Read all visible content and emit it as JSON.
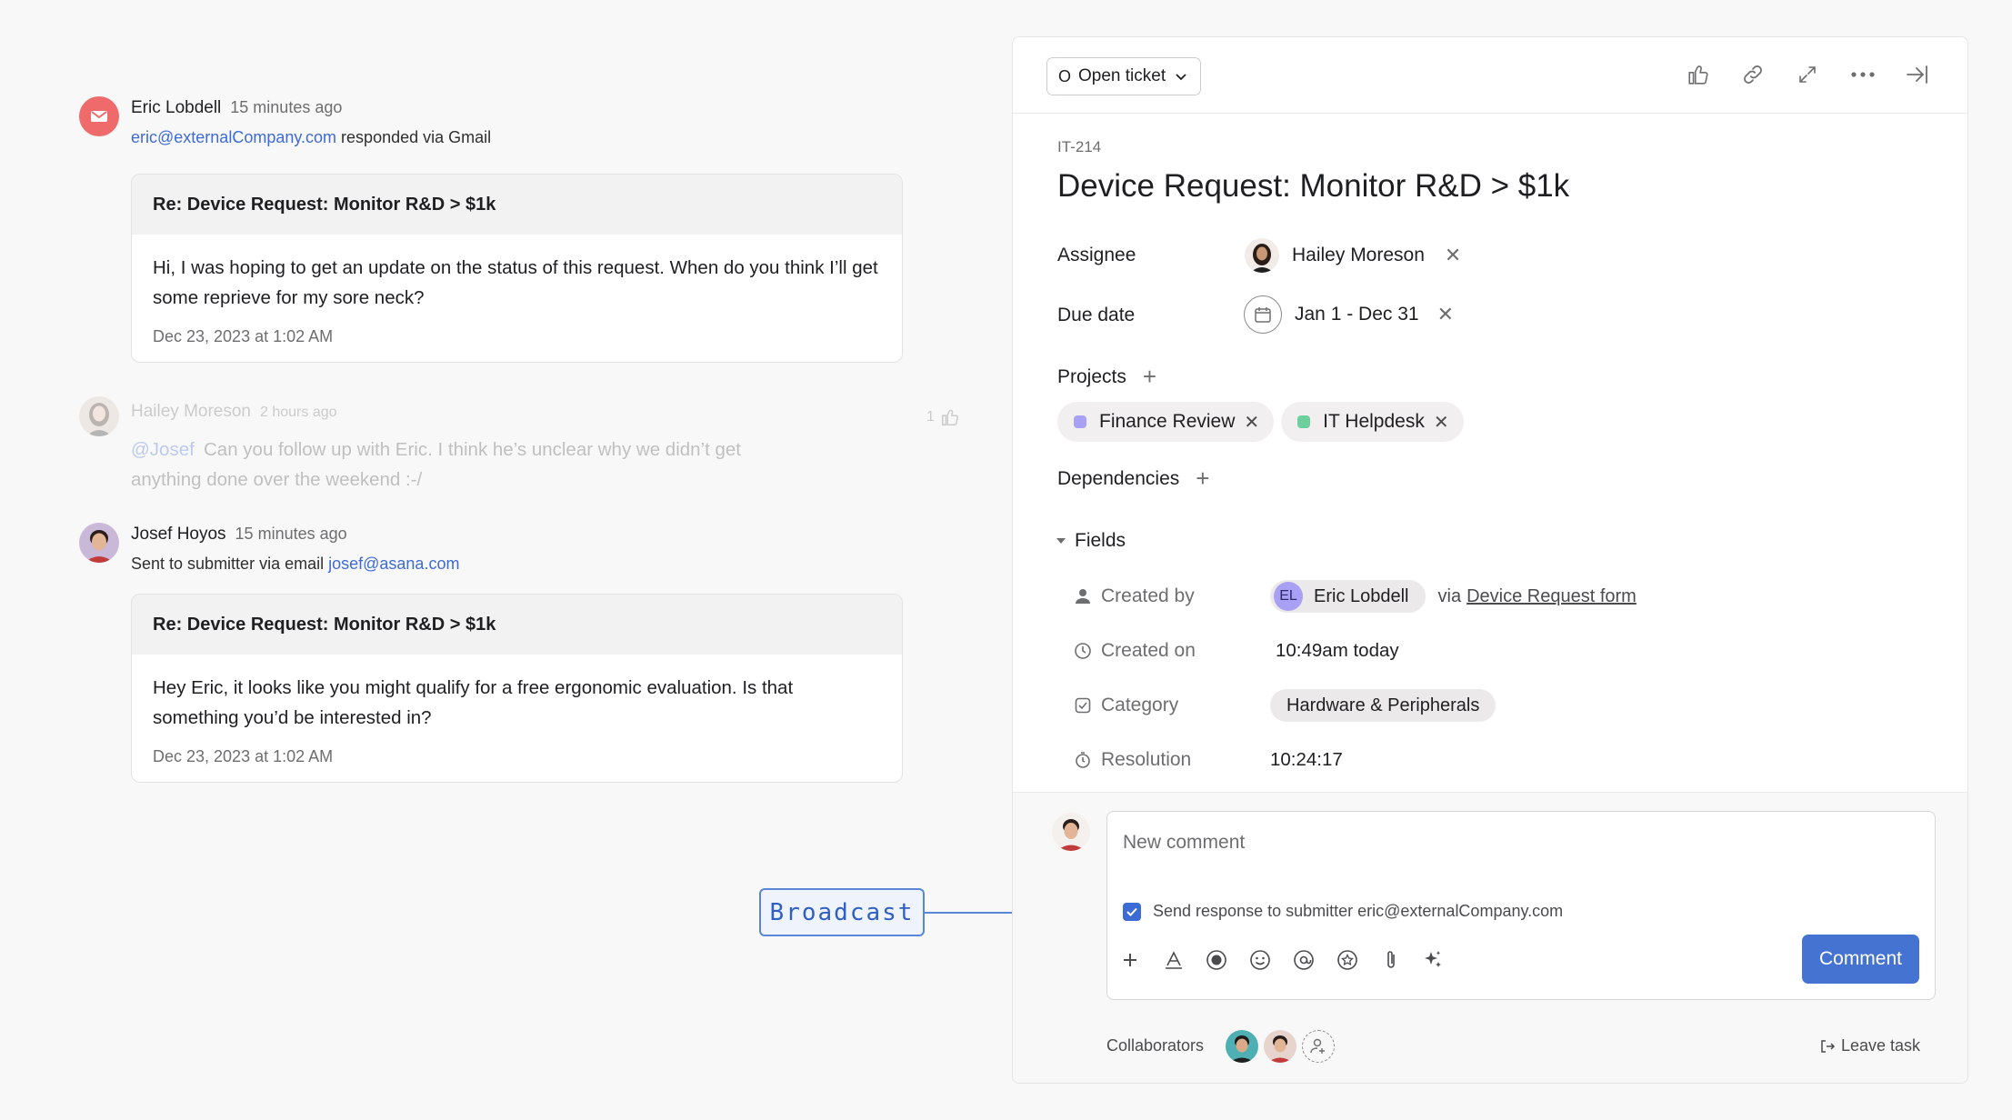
{
  "feed": {
    "email_event": {
      "name": "Eric Lobdell",
      "time": "15 minutes ago",
      "email": "eric@externalCompany.com",
      "action": "responded via Gmail",
      "card_title": "Re: Device Request: Monitor R&D > $1k",
      "card_body": "Hi, I was hoping to get an update on the status of this request. When do you think I’ll get some reprieve for my sore neck?",
      "card_date": "Dec 23, 2023 at 1:02 AM"
    },
    "internal_comment": {
      "name": "Hailey Moreson",
      "time": "2 hours ago",
      "mention": "@Josef",
      "text": "Can you follow up with Eric. I think he’s unclear why we didn’t get anything done over the weekend :-/",
      "likes": "1"
    },
    "reply_event": {
      "name": "Josef Hoyos",
      "time": "15 minutes ago",
      "action": "Sent to submitter via email",
      "email": "josef@asana.com",
      "card_title": "Re: Device Request: Monitor R&D > $1k",
      "card_body": "Hey Eric, it looks like you might qualify for a free ergonomic evaluation. Is that something you’d be interested in?",
      "card_date": "Dec 23, 2023 at 1:02 AM"
    }
  },
  "callout": {
    "label": "Broadcast"
  },
  "panel": {
    "toolbar": {
      "status_badge": "O",
      "status_label": "Open ticket",
      "icons": [
        "thumbs-up-icon",
        "link-icon",
        "expand-icon",
        "more-icon",
        "close-panel-icon"
      ]
    },
    "ticket_id": "IT-214",
    "title": "Device Request: Monitor R&D > $1k",
    "assignee": {
      "label": "Assignee",
      "value": "Hailey Moreson"
    },
    "due_date": {
      "label": "Due date",
      "value": "Jan 1 - Dec 31"
    },
    "projects": {
      "label": "Projects",
      "items": [
        {
          "name": "Finance Review",
          "color": "#a8a1f5"
        },
        {
          "name": "IT Helpdesk",
          "color": "#6ccf9c"
        }
      ]
    },
    "dependencies": {
      "label": "Dependencies"
    },
    "fields": {
      "label": "Fields",
      "created_by": {
        "label": "Created by",
        "initials": "EL",
        "name": "Eric Lobdell",
        "via": "via",
        "form": "Device Request form"
      },
      "created_on": {
        "label": "Created on",
        "value": "10:49am today"
      },
      "category": {
        "label": "Category",
        "value": "Hardware & Peripherals"
      },
      "resolution": {
        "label": "Resolution",
        "value": "10:24:17"
      }
    },
    "comment": {
      "placeholder": "New comment",
      "send_response": "Send response to submitter eric@externalCompany.com",
      "button": "Comment"
    },
    "collaborators_label": "Collaborators",
    "leave_task": "Leave task"
  }
}
